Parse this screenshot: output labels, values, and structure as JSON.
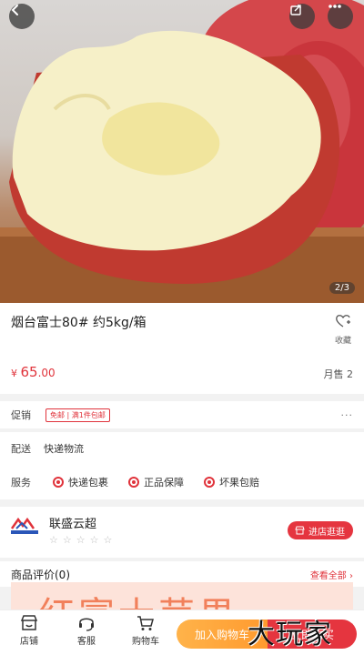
{
  "hero": {
    "pager": "2/3"
  },
  "product": {
    "title": "烟台富士80# 约5kg/箱",
    "fav_label": "收藏",
    "price_symbol": "¥",
    "price_int": "65",
    "price_dec": ".00",
    "sales": "月售 2"
  },
  "promo": {
    "label": "促销",
    "tag": "免邮 | 满1件包邮",
    "more": "···"
  },
  "shipping": {
    "label": "配送",
    "value": "快递物流"
  },
  "service": {
    "label": "服务",
    "items": [
      "快递包裹",
      "正品保障",
      "坏果包赔"
    ]
  },
  "store": {
    "name": "联盛云超",
    "stars": "☆☆☆☆☆",
    "enter_label": "进店逛逛"
  },
  "review": {
    "title": "商品评价(0)",
    "view_all": "查看全部 ›"
  },
  "banner": {
    "text": "红富士苹果"
  },
  "bottom_bar": {
    "tab_store": "店铺",
    "tab_service": "客服",
    "tab_cart": "购物车",
    "add_to_cart": "加入购物车",
    "buy_now": "立即购买"
  },
  "watermark": "大玩家",
  "colors": {
    "accent": "#e0333b",
    "orange": "#ff9a2e"
  }
}
